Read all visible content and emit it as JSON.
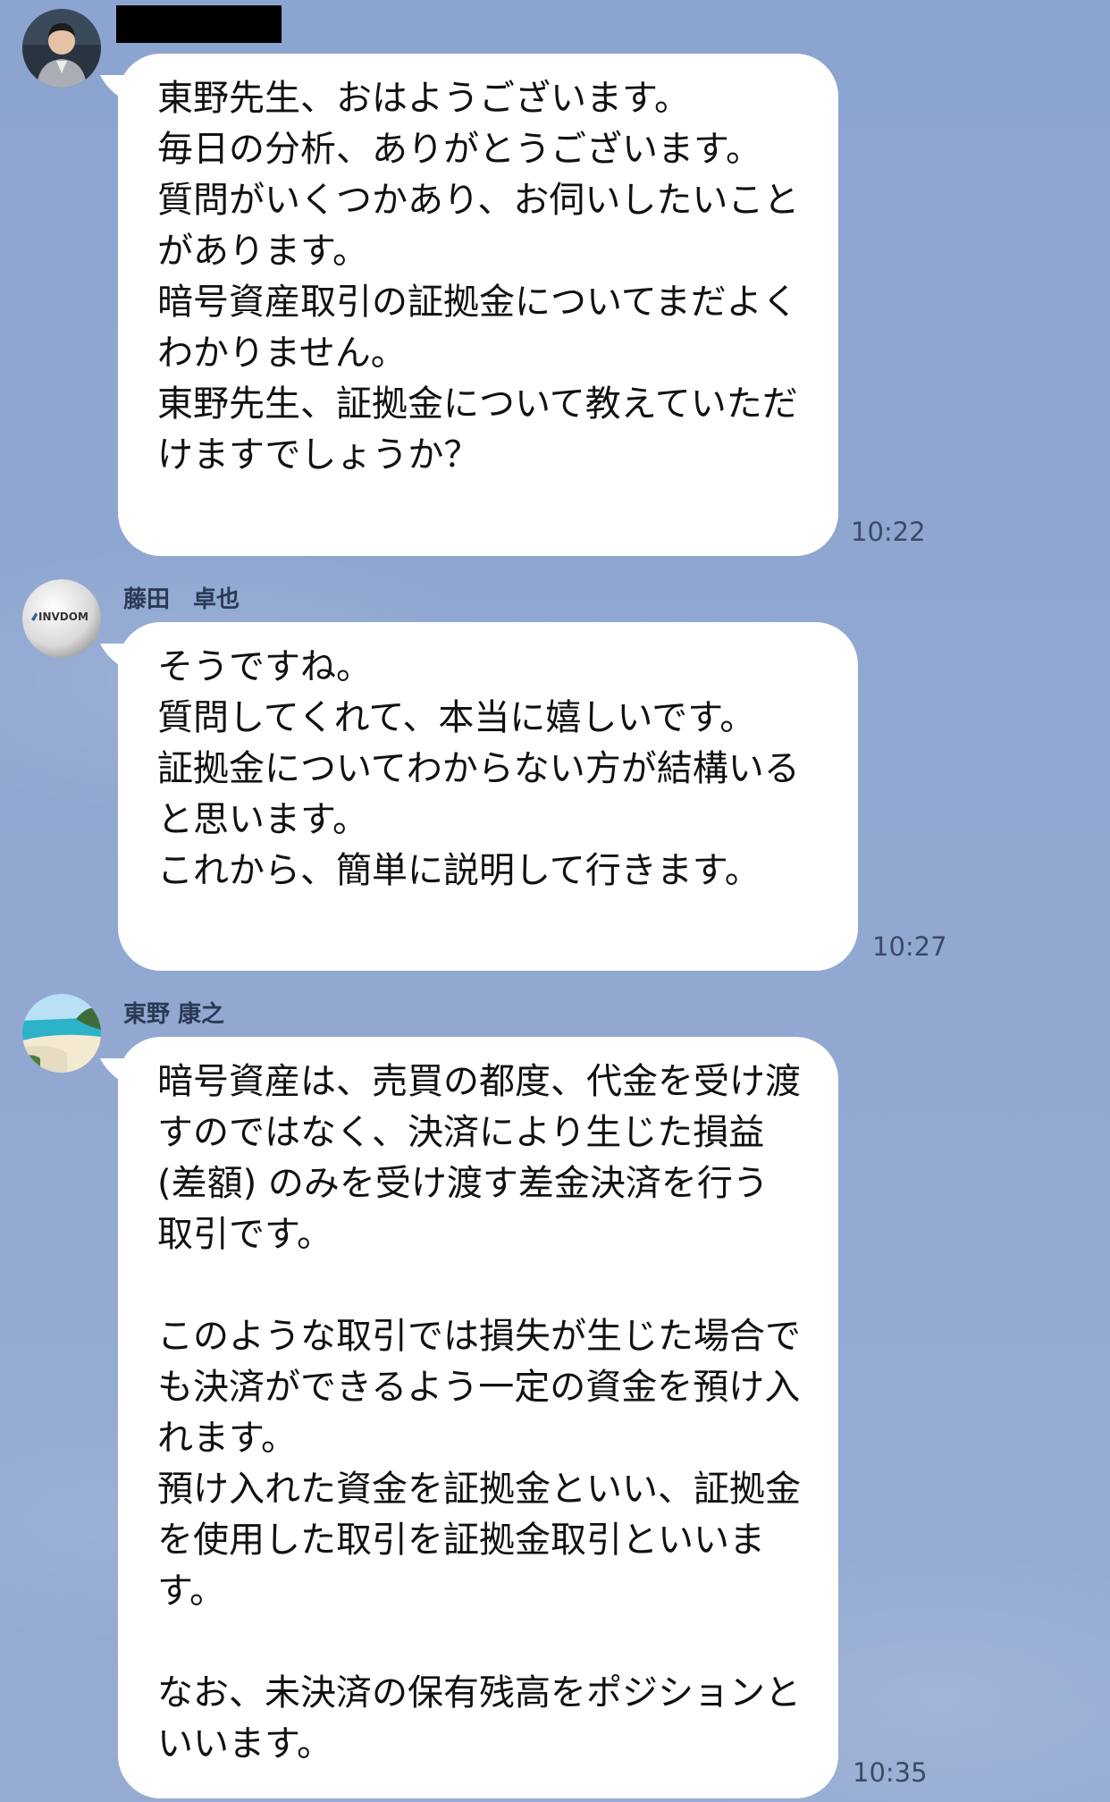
{
  "messages": [
    {
      "sender": "",
      "sender_redacted": true,
      "avatar": "person-photo-avatar",
      "text": "東野先生、おはようございます。\n毎日の分析、ありがとうございます。\n質問がいくつかあり、お伺いしたいことがあります。\n暗号資産取引の証拠金についてまだよくわかりません。\n東野先生、証拠金について教えていただけますでしょうか？",
      "time": "10:22"
    },
    {
      "sender": "藤田　卓也",
      "avatar": "invdom-logo-avatar",
      "avatar_text": "INVDOM",
      "text": "そうですね。\n質問してくれて、本当に嬉しいです。\n証拠金についてわからない方が結構いると思います。\nこれから、簡単に説明して行きます。",
      "time": "10:27"
    },
    {
      "sender": "東野 康之",
      "avatar": "beach-photo-avatar",
      "text": "暗号資産は、売買の都度、代金を受け渡すのではなく、決済により生じた損益 (差額) のみを受け渡す差金決済を行う取引です。\n\nこのような取引では損失が生じた場合でも決済ができるよう一定の資金を預け入れます。\n預け入れた資金を証拠金といい、証拠金を使用した取引を証拠金取引といいます。\n\nなお、未決済の保有残高をポジションといいます。",
      "time": "10:35"
    }
  ],
  "colors": {
    "background": "#8fa6cf",
    "bubble": "#ffffff",
    "text": "#111111",
    "sender": "#2b3a55",
    "time": "#3c4a66"
  }
}
